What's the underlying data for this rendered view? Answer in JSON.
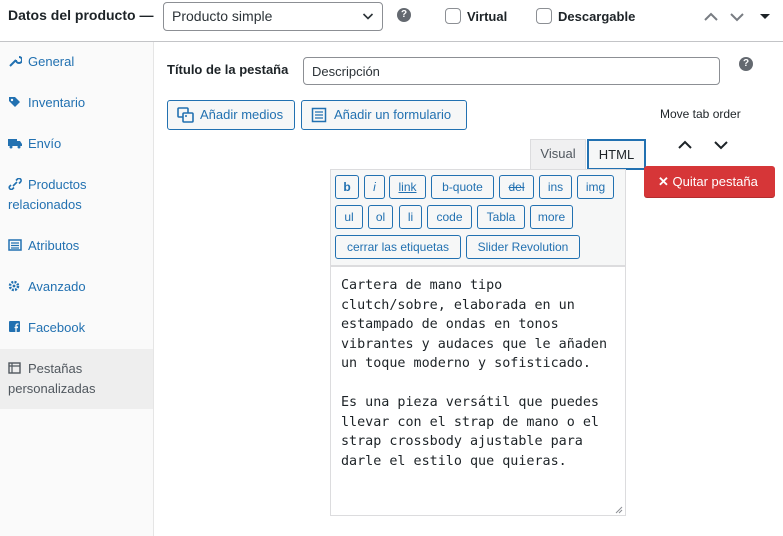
{
  "header": {
    "title": "Datos del producto —",
    "product_type": "Producto simple",
    "help": "?",
    "virtual_label": "Virtual",
    "downloadable_label": "Descargable"
  },
  "sidebar": {
    "items": [
      {
        "label": "General",
        "icon": "wrench-icon"
      },
      {
        "label": "Inventario",
        "icon": "tag-icon"
      },
      {
        "label": "Envío",
        "icon": "truck-icon"
      },
      {
        "label": "Productos relacionados",
        "icon": "link-icon"
      },
      {
        "label": "Atributos",
        "icon": "list-icon"
      },
      {
        "label": "Avanzado",
        "icon": "gear-icon"
      },
      {
        "label": "Facebook",
        "icon": "facebook-icon"
      },
      {
        "label": "Pestañas personalizadas",
        "icon": "table-icon"
      }
    ]
  },
  "tab_editor": {
    "title_label": "Título de la pestaña",
    "title_value": "Descripción",
    "help": "?",
    "add_media": "Añadir medios",
    "add_form": "Añadir un formulario",
    "move_tab_order": "Move tab order",
    "tab_visual": "Visual",
    "tab_html": "HTML",
    "remove_tab": "Quitar pestaña",
    "remove_icon": "✕",
    "quicktags": {
      "b": "b",
      "i": "i",
      "link": "link",
      "bquote": "b-quote",
      "del": "del",
      "ins": "ins",
      "img": "img",
      "ul": "ul",
      "ol": "ol",
      "li": "li",
      "code": "code",
      "tabla": "Tabla",
      "more": "more",
      "close": "cerrar las etiquetas",
      "slider": "Slider Revolution"
    },
    "content": "Cartera de mano tipo clutch/sobre, elaborada en un estampado de ondas en tonos vibrantes y audaces que le añaden un toque moderno y sofisticado.\n\nEs una pieza versátil que puedes llevar con el strap de mano o el strap crossbody ajustable para darle el estilo que quieras."
  },
  "colors": {
    "accent": "#2271b1",
    "danger": "#d63638",
    "text": "#1d2327"
  }
}
